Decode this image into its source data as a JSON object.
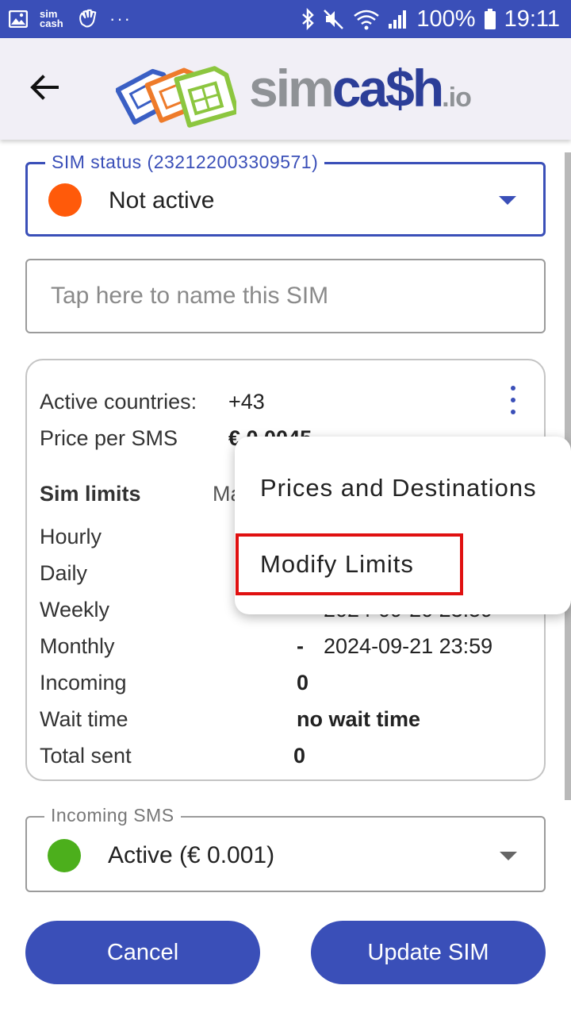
{
  "status_bar": {
    "notification_app": "sim\ncash",
    "overflow": "···",
    "battery": "100%",
    "time": "19:11"
  },
  "app_bar": {
    "logo": {
      "sim": "sim",
      "cash": "ca$h",
      "io": ".io"
    }
  },
  "sim_status": {
    "label": "SIM status (232122003309571)",
    "value": "Not active",
    "dot_color": "#ff5a0a"
  },
  "sim_name": {
    "placeholder": "Tap here to name this SIM"
  },
  "info_card": {
    "active_countries_label": "Active countries:",
    "active_countries_value": "+43",
    "price_label": "Price per SMS",
    "price_value": "€ 0.0045",
    "limits_heading": "Sim limits",
    "limits_col_header": "Ma",
    "rows": [
      {
        "label": "Hourly",
        "value": "",
        "date": ""
      },
      {
        "label": "Daily",
        "value": "",
        "date": ""
      },
      {
        "label": "Weekly",
        "value": "",
        "date": "2024-09-20 23:59"
      },
      {
        "label": "Monthly",
        "value": "-",
        "date": "2024-09-21 23:59"
      },
      {
        "label": "Incoming",
        "value": "0",
        "date": ""
      },
      {
        "label": "Wait time",
        "value": "no wait time",
        "date": ""
      },
      {
        "label": "Total sent",
        "value": "0",
        "date": ""
      }
    ]
  },
  "menu": {
    "items": [
      "Prices and Destinations",
      "Modify Limits"
    ]
  },
  "incoming_sms": {
    "label": "Incoming SMS",
    "value": "Active (€ 0.001)",
    "dot_color": "#4caf1c"
  },
  "buttons": {
    "cancel": "Cancel",
    "update": "Update SIM"
  },
  "colors": {
    "accent": "#3a4fb8",
    "highlight": "#e01010"
  }
}
